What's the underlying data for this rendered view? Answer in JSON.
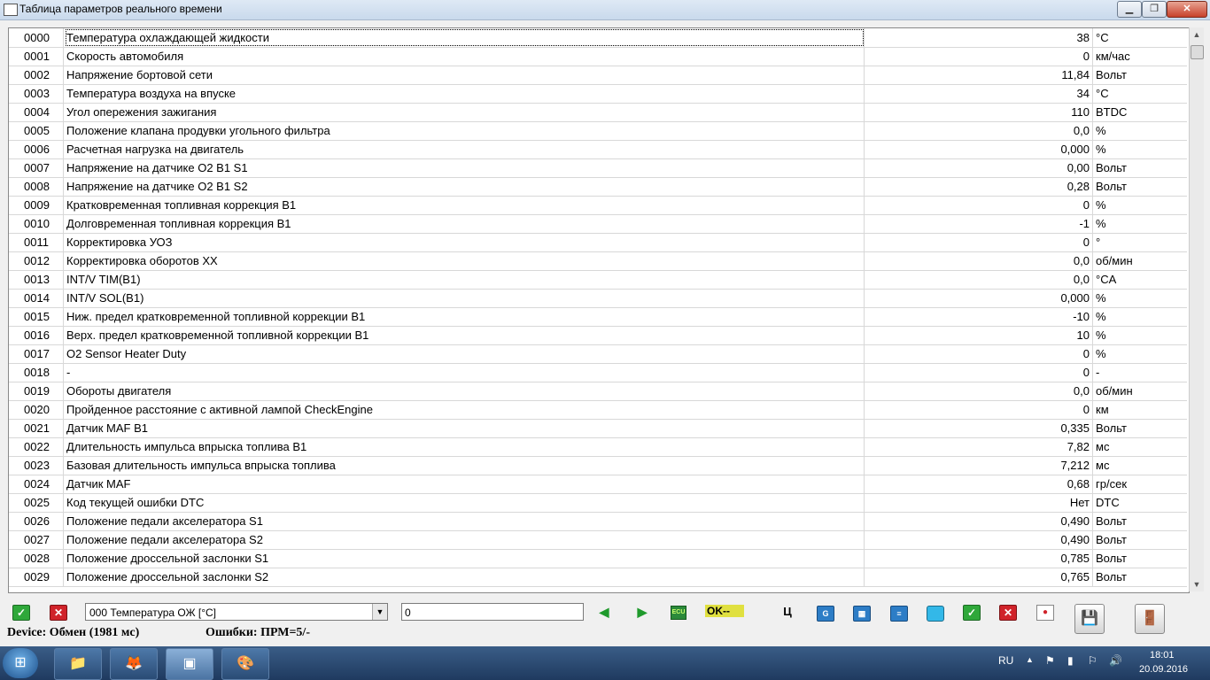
{
  "window": {
    "title": "Таблица параметров реального времени"
  },
  "rows": [
    {
      "id": "0000",
      "name": "Температура охлаждающей жидкости",
      "value": "38",
      "unit": "°C"
    },
    {
      "id": "0001",
      "name": "Скорость автомобиля",
      "value": "0",
      "unit": "км/час"
    },
    {
      "id": "0002",
      "name": "Напряжение бортовой сети",
      "value": "11,84",
      "unit": "Вольт"
    },
    {
      "id": "0003",
      "name": "Температура воздуха на впуске",
      "value": "34",
      "unit": "°C"
    },
    {
      "id": "0004",
      "name": "Угол опережения зажигания",
      "value": "110",
      "unit": "BTDC"
    },
    {
      "id": "0005",
      "name": "Положение клапана продувки угольного фильтра",
      "value": "0,0",
      "unit": "%"
    },
    {
      "id": "0006",
      "name": "Расчетная нагрузка на двигатель",
      "value": "0,000",
      "unit": "%"
    },
    {
      "id": "0007",
      "name": "Напряжение на датчике O2 B1 S1",
      "value": "0,00",
      "unit": "Вольт"
    },
    {
      "id": "0008",
      "name": "Напряжение на датчике O2 B1 S2",
      "value": "0,28",
      "unit": "Вольт"
    },
    {
      "id": "0009",
      "name": "Кратковременная топливная коррекция B1",
      "value": "0",
      "unit": "%"
    },
    {
      "id": "0010",
      "name": "Долговременная топливная коррекция B1",
      "value": "-1",
      "unit": "%"
    },
    {
      "id": "0011",
      "name": "Корректировка УОЗ",
      "value": "0",
      "unit": "°"
    },
    {
      "id": "0012",
      "name": "Корректировка оборотов ХХ",
      "value": "0,0",
      "unit": "об/мин"
    },
    {
      "id": "0013",
      "name": "INT/V TIM(B1)",
      "value": "0,0",
      "unit": "°CA"
    },
    {
      "id": "0014",
      "name": "INT/V SOL(B1)",
      "value": "0,000",
      "unit": "%"
    },
    {
      "id": "0015",
      "name": "Ниж. предел кратковременной топливной коррекции B1",
      "value": "-10",
      "unit": "%"
    },
    {
      "id": "0016",
      "name": "Верх. предел кратковременной топливной коррекции B1",
      "value": "10",
      "unit": "%"
    },
    {
      "id": "0017",
      "name": "O2 Sensor Heater Duty",
      "value": "0",
      "unit": "%"
    },
    {
      "id": "0018",
      "name": "-",
      "value": "0",
      "unit": "-"
    },
    {
      "id": "0019",
      "name": "Обороты двигателя",
      "value": "0,0",
      "unit": "об/мин"
    },
    {
      "id": "0020",
      "name": "Пройденное расстояние с активной лампой CheckEngine",
      "value": "0",
      "unit": "км"
    },
    {
      "id": "0021",
      "name": "Датчик MAF B1",
      "value": "0,335",
      "unit": "Вольт"
    },
    {
      "id": "0022",
      "name": "Длительность импульса впрыска топлива B1",
      "value": "7,82",
      "unit": "мс"
    },
    {
      "id": "0023",
      "name": "Базовая длительность импульса впрыска топлива",
      "value": "7,212",
      "unit": "мс"
    },
    {
      "id": "0024",
      "name": "Датчик MAF",
      "value": "0,68",
      "unit": "гр/сек"
    },
    {
      "id": "0025",
      "name": "Код текущей ошибки DTC",
      "value": "Нет",
      "unit": "DTC"
    },
    {
      "id": "0026",
      "name": "Положение педали акселератора S1",
      "value": "0,490",
      "unit": "Вольт"
    },
    {
      "id": "0027",
      "name": "Положение педали акселератора S2",
      "value": "0,490",
      "unit": "Вольт"
    },
    {
      "id": "0028",
      "name": "Положение дроссельной заслонки S1",
      "value": "0,785",
      "unit": "Вольт"
    },
    {
      "id": "0029",
      "name": "Положение дроссельной заслонки S2",
      "value": "0,765",
      "unit": "Вольт"
    }
  ],
  "toolbar": {
    "param_select": "000 Температура ОЖ [°C]",
    "value_input": "0",
    "ecu_label": "ECU",
    "ok_badge": "OK--",
    "c_button": "Ц",
    "g_button": "G"
  },
  "status": {
    "device": "Device: Обмен (1981 мс)",
    "errors": "Ошибки: ПРМ=5/-"
  },
  "taskbar": {
    "lang": "RU",
    "time": "18:01",
    "date": "20.09.2016"
  }
}
